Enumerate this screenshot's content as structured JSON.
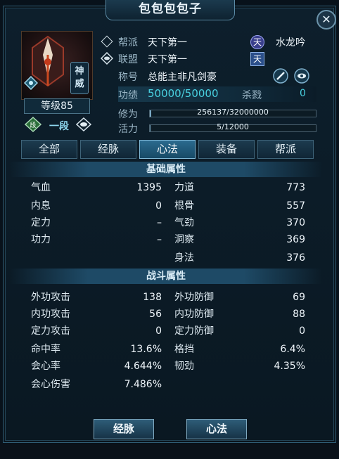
{
  "window": {
    "title": "包包包包子",
    "close_glyph": "✕"
  },
  "character": {
    "badge": "神威",
    "level": "等级85",
    "rank": "一段",
    "rank_icon_glyph": "段"
  },
  "info": {
    "guild": {
      "label": "帮派",
      "value": "天下第一",
      "badge": "天",
      "server": "水龙吟"
    },
    "alliance": {
      "label": "联盟",
      "value": "天下第一",
      "badge": "天"
    },
    "title": {
      "label": "称号",
      "value": "总能主非凡剑豪"
    },
    "merit": {
      "label": "功绩",
      "value": "50000/50000",
      "kill_label": "杀戮",
      "kill_value": "0"
    },
    "cultivation": {
      "label": "修为",
      "text": "256137/32000000",
      "fraction": 0.008
    },
    "vitality": {
      "label": "活力",
      "text": "5/12000",
      "fraction": 0.0004
    }
  },
  "tabs": [
    {
      "label": "全部"
    },
    {
      "label": "经脉"
    },
    {
      "label": "心法"
    },
    {
      "label": "装备"
    },
    {
      "label": "帮派"
    }
  ],
  "active_tab": "心法",
  "basic": {
    "title": "基础属性",
    "left": [
      {
        "k": "气血",
        "v": "1395"
      },
      {
        "k": "内息",
        "v": "0"
      },
      {
        "k": "定力",
        "v": "–"
      },
      {
        "k": "功力",
        "v": "–"
      }
    ],
    "right": [
      {
        "k": "力道",
        "v": "773"
      },
      {
        "k": "根骨",
        "v": "557"
      },
      {
        "k": "气劲",
        "v": "370"
      },
      {
        "k": "洞察",
        "v": "369"
      },
      {
        "k": "身法",
        "v": "376"
      }
    ]
  },
  "battle": {
    "title": "战斗属性",
    "left": [
      {
        "k": "外功攻击",
        "v": "138"
      },
      {
        "k": "内功攻击",
        "v": "56"
      },
      {
        "k": "定力攻击",
        "v": "0"
      },
      {
        "k": "命中率",
        "v": "13.6%"
      },
      {
        "k": "会心率",
        "v": "4.644%"
      },
      {
        "k": "会心伤害",
        "v": "7.486%"
      }
    ],
    "right": [
      {
        "k": "外功防御",
        "v": "69"
      },
      {
        "k": "内功防御",
        "v": "88"
      },
      {
        "k": "定力防御",
        "v": "0"
      },
      {
        "k": "格挡",
        "v": "6.4%"
      },
      {
        "k": "韧劲",
        "v": "4.35%"
      }
    ]
  },
  "buttons": {
    "meridian": "经脉",
    "xinfa": "心法"
  },
  "colors": {
    "accent": "#49d1e0",
    "panel": "#0d1f2c",
    "active_tab": "#2b6a8e"
  },
  "icons": [
    "close-icon",
    "faction-emblem-icon",
    "gem-icon",
    "rank-icon",
    "eye-icon",
    "diamond-icon",
    "brush-icon",
    "eye-badge-icon"
  ]
}
